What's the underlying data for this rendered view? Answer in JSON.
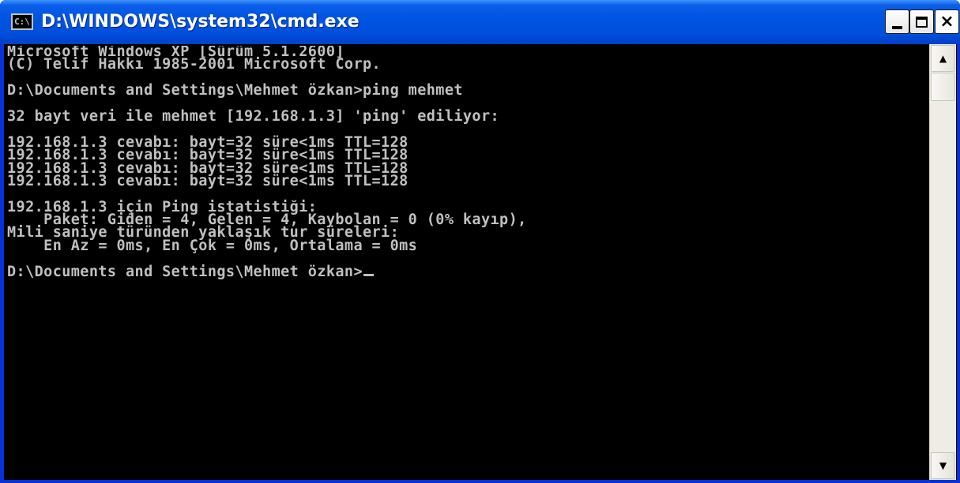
{
  "window": {
    "title": "D:\\WINDOWS\\system32\\cmd.exe",
    "app_icon": "cmd-icon",
    "app_icon_text": "C:\\",
    "controls": {
      "minimize": "minimize-icon",
      "maximize": "maximize-icon",
      "close": "close-icon",
      "close_glyph": "×"
    }
  },
  "console": {
    "lines": [
      "Microsoft Windows XP [Sürüm 5.1.2600]",
      "(C) Telif Hakkı 1985-2001 Microsoft Corp.",
      "",
      "D:\\Documents and Settings\\Mehmet özkan>ping mehmet",
      "",
      "32 bayt veri ile mehmet [192.168.1.3] 'ping' ediliyor:",
      "",
      "192.168.1.3 cevabı: bayt=32 süre<1ms TTL=128",
      "192.168.1.3 cevabı: bayt=32 süre<1ms TTL=128",
      "192.168.1.3 cevabı: bayt=32 süre<1ms TTL=128",
      "192.168.1.3 cevabı: bayt=32 süre<1ms TTL=128",
      "",
      "192.168.1.3 için Ping istatistiği:",
      "    Paket: Giden = 4, Gelen = 4, Kaybolan = 0 (0% kayıp),",
      "Mili saniye türünden yaklaşık tur süreleri:",
      "    En Az = 0ms, En Çok = 0ms, Ortalama = 0ms",
      ""
    ],
    "prompt": "D:\\Documents and Settings\\Mehmet özkan>"
  },
  "scrollbar": {
    "up_icon": "scroll-up-arrow-icon",
    "down_icon": "scroll-down-arrow-icon",
    "up_glyph": "▲",
    "down_glyph": "▼"
  }
}
